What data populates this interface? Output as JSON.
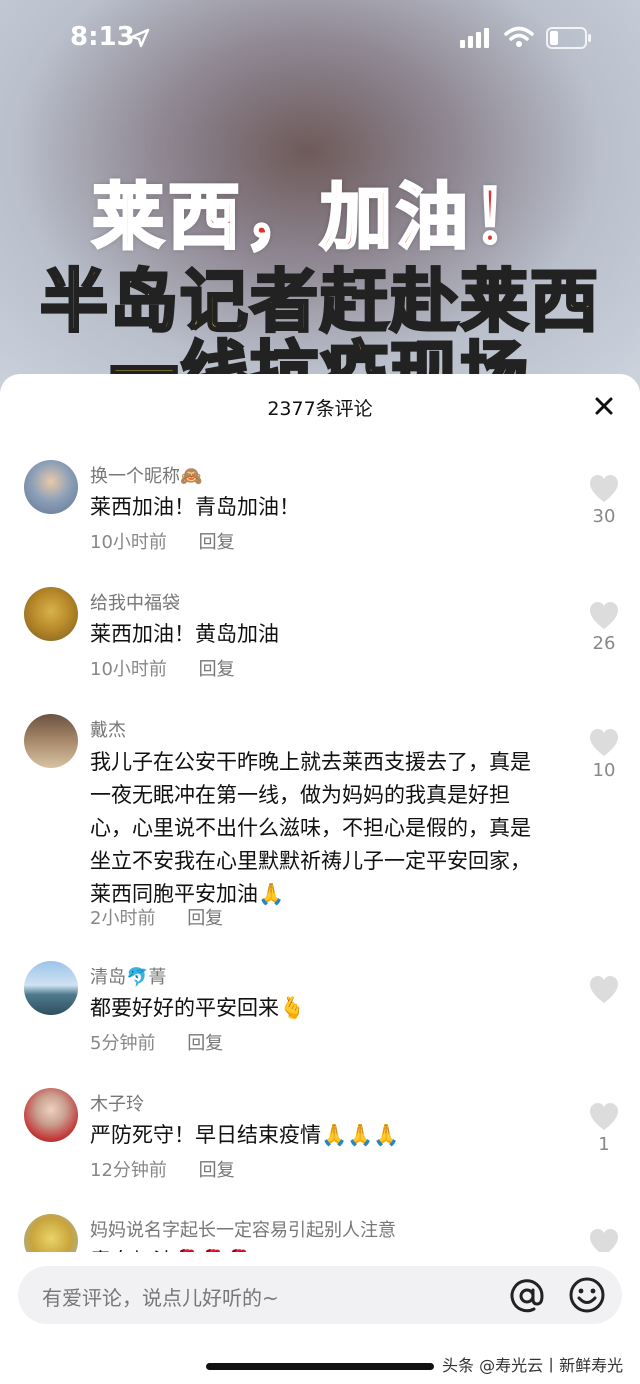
{
  "status_bar": {
    "time": "8:13"
  },
  "video": {
    "headline_line1": "莱西，加油！",
    "headline_line2": "半岛记者赶赴莱西",
    "headline_line3": "一线抗疫现场"
  },
  "comments_panel": {
    "title": "2377条评论",
    "comments": [
      {
        "nickname": "换一个昵称🙈",
        "text": "莱西加油！青岛加油！",
        "time": "10小时前",
        "reply": "回复",
        "likes": "30"
      },
      {
        "nickname": "给我中福袋",
        "text": "莱西加油！黄岛加油",
        "time": "10小时前",
        "reply": "回复",
        "likes": "26"
      },
      {
        "nickname": "戴杰",
        "text": "我儿子在公安干昨晚上就去莱西支援去了，真是一夜无眠冲在第一线，做为妈妈的我真是好担心，心里说不出什么滋味，不担心是假的，真是坐立不安我在心里默默祈祷儿子一定平安回家，莱西同胞平安加油🙏",
        "time": "2小时前",
        "reply": "回复",
        "likes": "10"
      },
      {
        "nickname": "清岛🐬菁",
        "text": "都要好好的平安回来🫰",
        "time": "5分钟前",
        "reply": "回复",
        "likes": ""
      },
      {
        "nickname": "木子玲",
        "text": "严防死守！早日结束疫情🙏🙏🙏",
        "time": "12分钟前",
        "reply": "回复",
        "likes": "1"
      },
      {
        "nickname": "妈妈说名字起长一定容易引起别人注意",
        "text": "青岛加油🌹🌹🌹",
        "time": "",
        "reply": "",
        "likes": ""
      }
    ]
  },
  "input": {
    "placeholder": "有爱评论，说点儿好听的~"
  },
  "watermark": "头条 @寿光云丨新鲜寿光"
}
